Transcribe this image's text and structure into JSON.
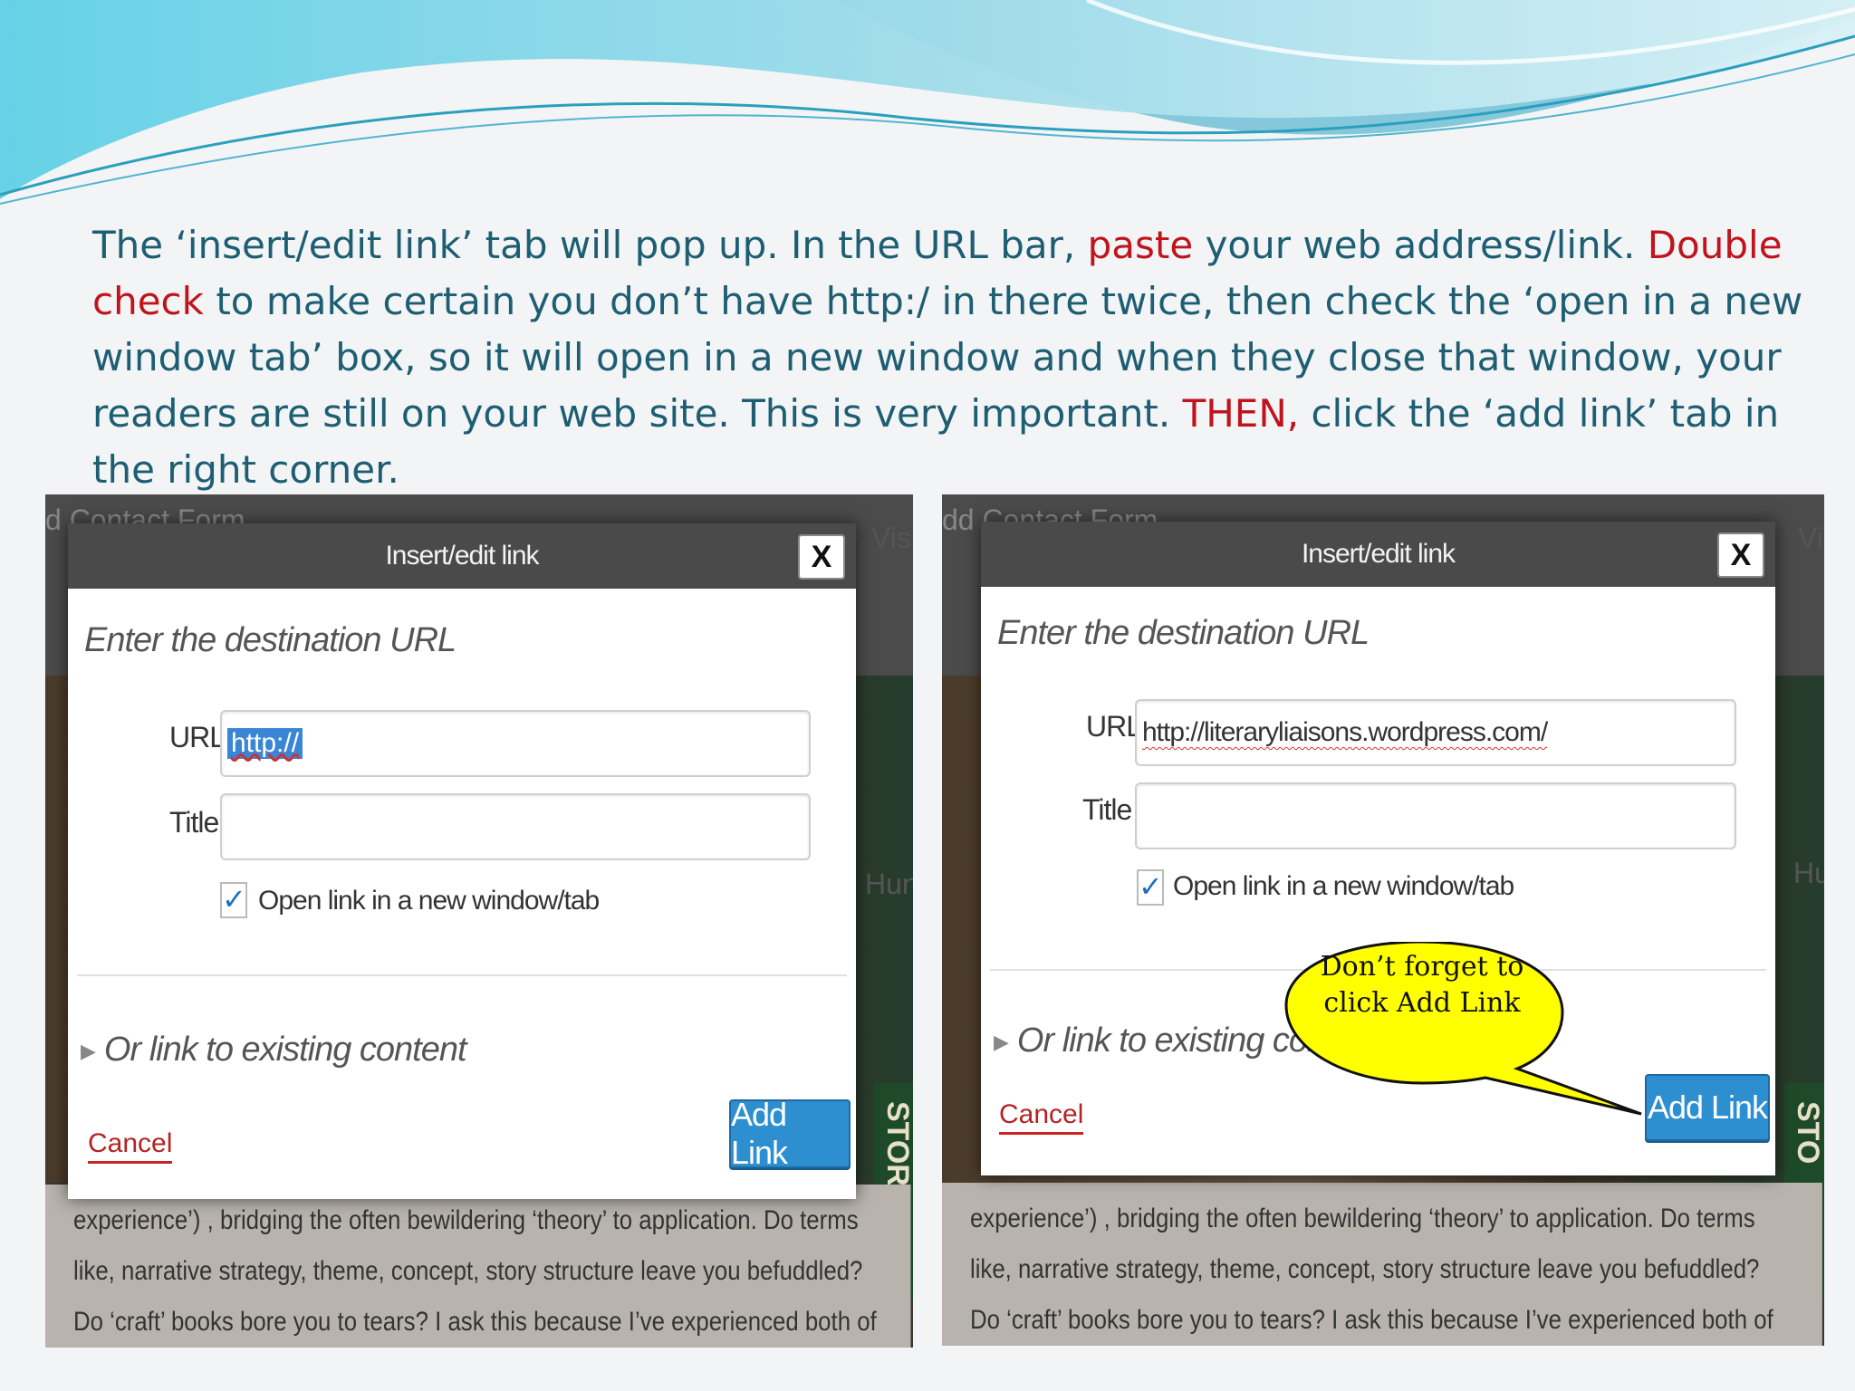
{
  "instructions": {
    "p1": "The ‘insert/edit link’ tab will pop up. In the URL bar, ",
    "r1": "paste",
    "p2": " your web address/link. ",
    "r2": "Double check",
    "p3": " to make certain you don’t have http:/ in there twice, then check the ‘open in a new window tab’ box, so it will open in a new window and when they close that window, your readers are still on your web site. This is very important. ",
    "r3": "THEN,",
    "p4": " click the ‘add link’ tab in the right corner."
  },
  "colors": {
    "teal_text": "#1d5e72",
    "emphasis_red": "#c0141c",
    "add_button_blue": "#2e8fd0",
    "callout_yellow": "#ffff00"
  },
  "left": {
    "bg_top_text": "d Contact Form",
    "side_visual": "Visu",
    "side_hung": "Hun",
    "book_text": "STOR",
    "dialog": {
      "title": "Insert/edit link",
      "close": "X",
      "subtitle": "Enter the destination URL",
      "url_label": "URL",
      "url_value": "http://",
      "title_label": "Title",
      "title_value": "",
      "checkbox_checked": true,
      "checkbox_label": "Open link in a new window/tab",
      "existing": "Or link to existing content",
      "cancel": "Cancel",
      "add_link": "Add Link"
    },
    "bg_lines": [
      "experience’) , bridging the often bewildering ‘theory’ to application.  Do terms",
      "like, narrative strategy, theme, concept, story structure leave you befuddled?",
      "Do ‘craft’ books bore you to tears?  I ask this because I’ve experienced both of"
    ]
  },
  "right": {
    "bg_top_text": "dd Contact Form",
    "side_visual": "Vi",
    "side_hung": "Hu",
    "book_text": "STO",
    "dialog": {
      "title": "Insert/edit link",
      "close": "X",
      "subtitle": "Enter the destination URL",
      "url_label": "URL",
      "url_value": "http://literaryliaisons.wordpress.com/",
      "title_label": "Title",
      "title_value": "",
      "checkbox_checked": true,
      "checkbox_label": "Open link in a new window/tab",
      "existing": "Or link to existing content",
      "cancel": "Cancel",
      "add_link": "Add Link"
    },
    "bg_lines": [
      "experience’) , bridging the often bewildering ‘theory’ to application.  Do terms",
      "like, narrative strategy, theme, concept, story structure leave you befuddled?",
      "Do ‘craft’ books bore you to tears?  I ask this because I’ve experienced both of"
    ]
  },
  "callout": {
    "text": "Don’t forget to click Add Link"
  },
  "icons": {
    "checkmark": "check-icon",
    "close": "close-icon",
    "expand": "triangle-right-icon"
  }
}
